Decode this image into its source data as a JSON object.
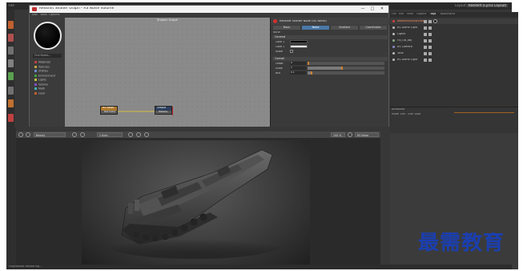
{
  "app": {
    "menu_right": "Layout:",
    "layout_value": "Redshift (Cyclic Layout)"
  },
  "shader_graph": {
    "window_title": "Redshift Shader Graph - RS Noise Volume",
    "window_buttons": [
      "—",
      "□",
      "✕"
    ],
    "menu": [
      "Edit",
      "Tools",
      "Options"
    ],
    "graph_title": "Shader Graph",
    "node_search_placeholder": "Find Nodes...",
    "node_categories": [
      {
        "label": "Materials",
        "color": "#c04040"
      },
      {
        "label": "Textures",
        "color": "#c0a040"
      },
      {
        "label": "Utilities",
        "color": "#6a8ac8"
      },
      {
        "label": "Environment",
        "color": "#40a040"
      },
      {
        "label": "Lights",
        "color": "#c0c040"
      },
      {
        "label": "Volume",
        "color": "#8050c0"
      },
      {
        "label": "Math",
        "color": "#40b0b0"
      },
      {
        "label": "Color",
        "color": "#c06030"
      }
    ],
    "nodes": [
      {
        "title": "RS Noise",
        "port": "Out Color"
      },
      {
        "title": "Output",
        "port": "Volume"
      }
    ],
    "attributes": {
      "header": "Redshift Shader Node (RS Noise)",
      "tabs": [
        "Basic",
        "Noise",
        "Gradient",
        "Coordinates"
      ],
      "active_tab": 1,
      "sub_label": "Noise",
      "general_section": "General",
      "general_rows": [
        {
          "label": "Color 1",
          "swatch": "#000000"
        },
        {
          "label": "Color 2",
          "swatch": "#ffffff"
        },
        {
          "label": "Invert",
          "value": ""
        }
      ],
      "overall_section": "Overall",
      "overall_rows": [
        {
          "label": "Offset",
          "value": "0",
          "fill": 0.0
        },
        {
          "label": "Scale",
          "value": "1",
          "fill": 0.45
        },
        {
          "label": "Blur",
          "value": "0.1",
          "fill": 0.05
        }
      ]
    }
  },
  "object_manager": {
    "menu": [
      "File",
      "Edit",
      "View",
      "Objects",
      "Tags",
      "Bookmarks"
    ],
    "items": [
      {
        "label": "RedshiftEnvironment",
        "color": "#d04040",
        "highlight": true
      },
      {
        "label": "RS Dome Light",
        "color": "#bbbbbb",
        "highlight": false
      },
      {
        "label": "Lights",
        "color": "#bbbbbb",
        "highlight": false
      },
      {
        "label": "Fill_OB_obj",
        "color": "#88aa88",
        "highlight": false
      },
      {
        "label": "RS Camera",
        "color": "#8888cc",
        "highlight": false
      },
      {
        "label": "Tank",
        "color": "#bbbbbb",
        "highlight": false
      },
      {
        "label": "RS Dome Light",
        "color": "#bbbbbb",
        "highlight": false
      }
    ],
    "attr_title": "Attributes",
    "attr_menu": [
      "Mode",
      "Edit",
      "User Data"
    ]
  },
  "viewport": {
    "view_drop": "Beauty",
    "aov_drop": "1 Auto",
    "zoom": "100 %",
    "display_drop": "RS Noise"
  },
  "status": {
    "text": "Progressive Rendering..."
  },
  "watermark": {
    "text": "最需教育"
  }
}
